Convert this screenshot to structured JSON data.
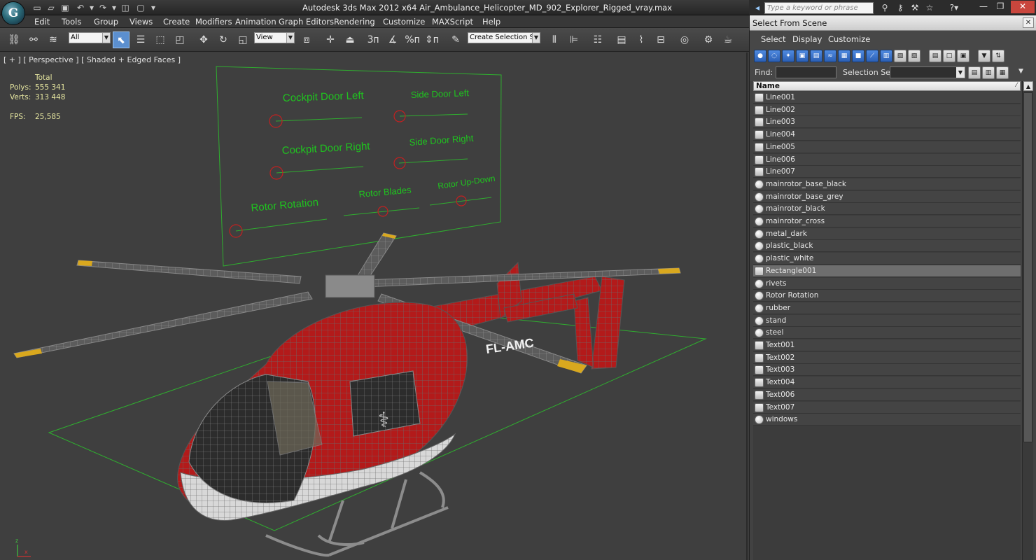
{
  "app": {
    "logo_glyph": "G",
    "window_title": "Autodesk 3ds Max  2012 x64     Air_Ambulance_Helicopter_MD_902_Explorer_Rigged_vray.max"
  },
  "menu": [
    "Edit",
    "Tools",
    "Group",
    "Views",
    "Create",
    "Modifiers",
    "Animation",
    "Graph Editors",
    "Rendering",
    "Customize",
    "MAXScript",
    "Help"
  ],
  "toolbar": {
    "filter_value": "All",
    "ref_coord_value": "View",
    "selection_set_value": "Create Selection Se"
  },
  "help": {
    "search_placeholder": "Type a keyword or phrase"
  },
  "viewport": {
    "label": "[ + ] [ Perspective ] [ Shaded + Edged Faces ]",
    "stats": {
      "total_label": "Total",
      "polys_label": "Polys:",
      "polys_value": "555 341",
      "verts_label": "Verts:",
      "verts_value": "313 448",
      "fps_label": "FPS:",
      "fps_value": "25,585"
    },
    "rig_labels": {
      "cockpit_left": "Cockpit Door Left",
      "side_left": "Side Door Left",
      "cockpit_right": "Cockpit Door Right",
      "side_right": "Side Door Right",
      "rotor_rotation": "Rotor Rotation",
      "rotor_blades": "Rotor Blades",
      "rotor_updown": "Rotor Up-Down"
    },
    "hull_text": "FL-AMC",
    "colors": {
      "rig": "#1fc31f",
      "body_red": "#b01818",
      "wire": "#7a7a7a",
      "blade_tip": "#d9a81e"
    }
  },
  "dialog": {
    "title": "Select From Scene",
    "close_glyph": "✕",
    "menu": [
      "Select",
      "Display",
      "Customize"
    ],
    "find_label": "Find:",
    "find_value": "",
    "selection_set_label": "Selection Set:",
    "selection_set_value": "",
    "column_name": "Name",
    "objects": [
      {
        "name": "Line001",
        "kind": "shape"
      },
      {
        "name": "Line002",
        "kind": "shape"
      },
      {
        "name": "Line003",
        "kind": "shape"
      },
      {
        "name": "Line004",
        "kind": "shape"
      },
      {
        "name": "Line005",
        "kind": "shape"
      },
      {
        "name": "Line006",
        "kind": "shape"
      },
      {
        "name": "Line007",
        "kind": "shape"
      },
      {
        "name": "mainrotor_base_black",
        "kind": "geometry"
      },
      {
        "name": "mainrotor_base_grey",
        "kind": "geometry"
      },
      {
        "name": "mainrotor_black",
        "kind": "geometry"
      },
      {
        "name": "mainrotor_cross",
        "kind": "geometry"
      },
      {
        "name": "metal_dark",
        "kind": "geometry"
      },
      {
        "name": "plastic_black",
        "kind": "geometry"
      },
      {
        "name": "plastic_white",
        "kind": "geometry"
      },
      {
        "name": "Rectangle001",
        "kind": "shape",
        "selected": true
      },
      {
        "name": "rivets",
        "kind": "geometry"
      },
      {
        "name": "Rotor Rotation",
        "kind": "geometry"
      },
      {
        "name": "rubber",
        "kind": "geometry"
      },
      {
        "name": "stand",
        "kind": "geometry"
      },
      {
        "name": "steel",
        "kind": "geometry"
      },
      {
        "name": "Text001",
        "kind": "shape"
      },
      {
        "name": "Text002",
        "kind": "shape"
      },
      {
        "name": "Text003",
        "kind": "shape"
      },
      {
        "name": "Text004",
        "kind": "shape"
      },
      {
        "name": "Text006",
        "kind": "shape"
      },
      {
        "name": "Text007",
        "kind": "shape"
      },
      {
        "name": "windows",
        "kind": "geometry"
      }
    ]
  }
}
